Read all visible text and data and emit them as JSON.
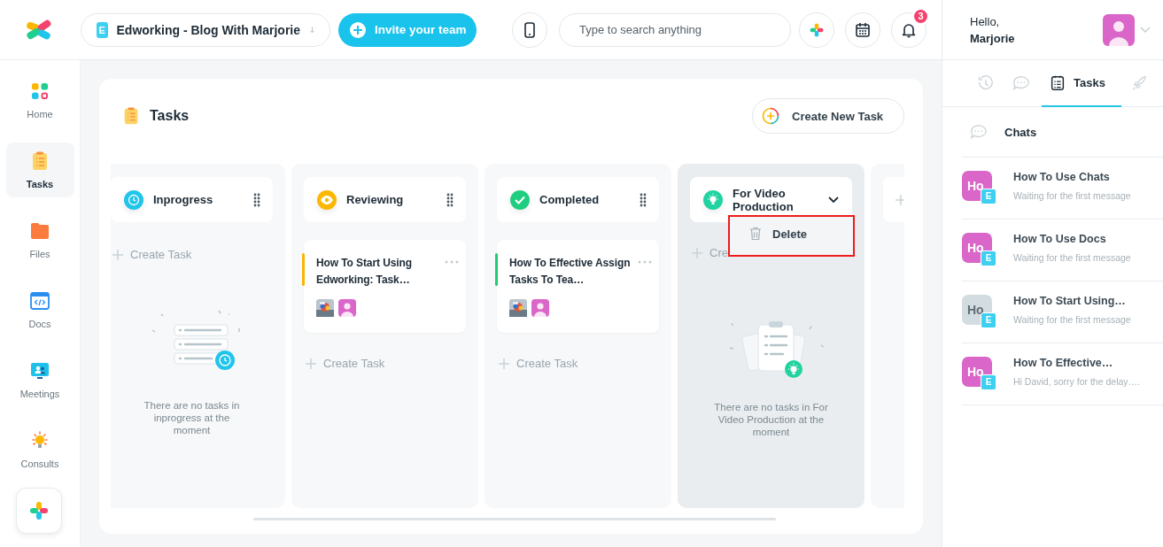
{
  "topbar": {
    "workspace": {
      "badge": "E",
      "name": "Edworking - Blog With Marjorie"
    },
    "invite_button": "Invite your team",
    "search": {
      "placeholder": "Type to search anything"
    },
    "notifications": {
      "count": "3"
    }
  },
  "user": {
    "greeting": "Hello,",
    "name": "Marjorie"
  },
  "sidebar": {
    "items": [
      {
        "kind": "home",
        "label": "Home",
        "selected": false
      },
      {
        "kind": "tasks",
        "label": "Tasks",
        "selected": true
      },
      {
        "kind": "files",
        "label": "Files",
        "selected": false
      },
      {
        "kind": "docs",
        "label": "Docs",
        "selected": false
      },
      {
        "kind": "meetings",
        "label": "Meetings",
        "selected": false
      },
      {
        "kind": "consults",
        "label": "Consults",
        "selected": false
      }
    ]
  },
  "board": {
    "title": "Tasks",
    "create_button": "Create New Task",
    "columns": [
      {
        "title": "Inprogress",
        "kind": "clock",
        "color": "#22c5ea",
        "selected": false,
        "expanded": false,
        "create_label": "Create Task",
        "empty_text": "There are no tasks in inprogress at the moment"
      },
      {
        "title": "Reviewing",
        "kind": "eye",
        "color": "#fbb800",
        "selected": false,
        "expanded": false,
        "tasks": [
          {
            "title": "How To Start Using Edworking: Task…",
            "color": "#fbb400",
            "assignees": [
              {
                "kind": "picture"
              },
              {
                "kind": "person"
              }
            ]
          }
        ],
        "create_label": "Create Task"
      },
      {
        "title": "Completed",
        "kind": "check",
        "color": "#1fcf7f",
        "selected": false,
        "expanded": false,
        "tasks": [
          {
            "title": "How To Effective Assign Tasks To Tea…",
            "color": "#21cc74",
            "assignees": [
              {
                "kind": "picture"
              },
              {
                "kind": "person"
              }
            ]
          }
        ],
        "create_label": "Create Task"
      },
      {
        "title": "For Video Production",
        "kind": "bulb",
        "color": "#20d3a0",
        "selected": true,
        "expanded": true,
        "menu": [
          {
            "label": "Delete"
          }
        ],
        "create_label": "Cre",
        "empty_text": "There are no tasks in For Video Production at the moment"
      }
    ]
  },
  "right_panel": {
    "tabs": [
      {
        "kind": "history",
        "selected": false
      },
      {
        "kind": "chat",
        "selected": false
      },
      {
        "kind": "tasks",
        "label": "Tasks",
        "selected": true
      },
      {
        "kind": "rocket",
        "selected": false
      }
    ],
    "section_title": "Chats",
    "chats": [
      {
        "title": "How To Use Chats",
        "preview": "Waiting for the first message",
        "avatar_text": "Ho",
        "badge": "E",
        "color": "#d966c8"
      },
      {
        "title": "How To Use Docs",
        "preview": "Waiting for the first message",
        "avatar_text": "Ho",
        "badge": "E",
        "color": "#d966c8"
      },
      {
        "title": "How To Start Using…",
        "preview": "Waiting for the first message",
        "avatar_text": "Ho",
        "badge": "E",
        "color": "#d3dde1"
      },
      {
        "title": "How To Effective…",
        "preview": "Hi David, sorry for the delay….",
        "avatar_text": "Ho",
        "badge": "E",
        "color": "#d966c8"
      }
    ]
  }
}
